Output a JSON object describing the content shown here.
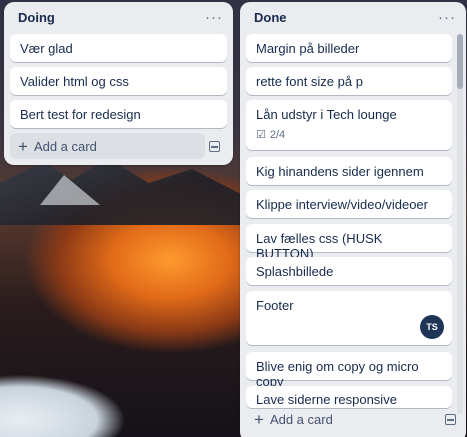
{
  "lists": [
    {
      "title": "Doing",
      "more": "···",
      "cards": [
        {
          "text": "Vær glad"
        },
        {
          "text": "Valider html og css"
        },
        {
          "text": "Bert test for redesign"
        }
      ],
      "add_card": "Add a card"
    },
    {
      "title": "Done",
      "more": "···",
      "cards": [
        {
          "text": "Margin på billeder"
        },
        {
          "text": "rette font size på p"
        },
        {
          "text": "Lån udstyr i Tech lounge",
          "checklist": "2/4"
        },
        {
          "text": "Kig hinandens sider igennem"
        },
        {
          "text": "Klippe interview/video/videoer"
        },
        {
          "text": "Lav fælles css (HUSK BUTTON)"
        },
        {
          "text": "Splashbillede"
        },
        {
          "text": "Footer",
          "avatar": "TS"
        },
        {
          "text": "Blive enig om copy og micro copy"
        },
        {
          "text": "Lave siderne responsive"
        }
      ],
      "add_card": "Add a card"
    }
  ],
  "icons": {
    "plus": "+",
    "checklist": "☑"
  },
  "colors": {
    "list_bg": "#ebecf0",
    "card_bg": "#ffffff",
    "text": "#172b4d",
    "avatar_bg": "#1e3557"
  }
}
